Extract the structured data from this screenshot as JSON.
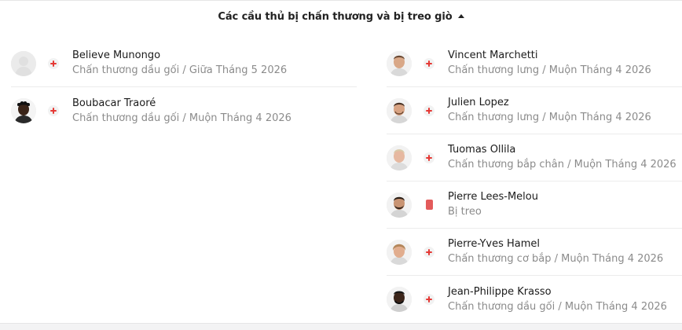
{
  "header": {
    "title": "Các cầu thủ bị chấn thương và bị treo giò"
  },
  "colors": {
    "injury": "#e53935",
    "suspension": "#e35b5b"
  },
  "left_players": [
    {
      "name": "Believe Munongo",
      "detail": "Chấn thương dầu gối / Giữa Tháng 5 2026",
      "status_icon": "injury-cross-icon",
      "avatar": "placeholder"
    },
    {
      "name": "Boubacar Traoré",
      "detail": "Chấn thương dầu gối / Muộn Tháng 4 2026",
      "status_icon": "injury-cross-icon",
      "avatar": "photo"
    }
  ],
  "right_players": [
    {
      "name": "Vincent Marchetti",
      "detail": "Chấn thương lưng / Muộn Tháng 4 2026",
      "status_icon": "injury-cross-icon",
      "avatar": "photo"
    },
    {
      "name": "Julien Lopez",
      "detail": "Chấn thương lưng / Muộn Tháng 4 2026",
      "status_icon": "injury-cross-icon",
      "avatar": "photo"
    },
    {
      "name": "Tuomas Ollila",
      "detail": "Chấn thương bắp chân / Muộn Tháng 4 2026",
      "status_icon": "injury-cross-icon",
      "avatar": "photo"
    },
    {
      "name": "Pierre Lees-Melou",
      "detail": "Bị treo",
      "status_icon": "red-card-icon",
      "avatar": "photo"
    },
    {
      "name": "Pierre-Yves Hamel",
      "detail": "Chấn thương cơ bắp / Muộn Tháng 4 2026",
      "status_icon": "injury-cross-icon",
      "avatar": "photo"
    },
    {
      "name": "Jean-Philippe Krasso",
      "detail": "Chấn thương dầu gối / Muộn Tháng 4 2026",
      "status_icon": "injury-cross-icon",
      "avatar": "photo"
    }
  ]
}
